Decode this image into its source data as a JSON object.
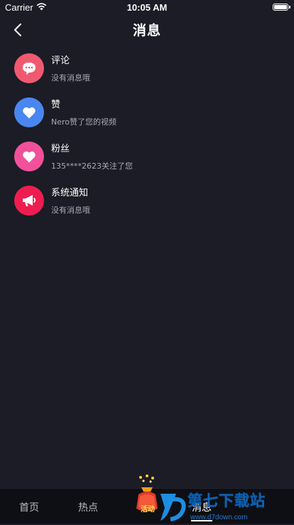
{
  "status": {
    "carrier": "Carrier",
    "time": "10:05 AM"
  },
  "nav": {
    "title": "消息"
  },
  "messages": [
    {
      "title": "评论",
      "subtitle": "没有消息哦",
      "icon": "comment-icon",
      "color": "#f05a70"
    },
    {
      "title": "赞",
      "subtitle": "Nero赞了您的视频",
      "icon": "heart-icon",
      "color": "#4a86f0"
    },
    {
      "title": "粉丝",
      "subtitle": "135****2623关注了您",
      "icon": "heart-icon",
      "color": "#f0519a"
    },
    {
      "title": "系统通知",
      "subtitle": "没有消息哦",
      "icon": "megaphone-icon",
      "color": "#ee1d50"
    }
  ],
  "tabs": [
    "首页",
    "热点",
    "消息"
  ],
  "promo": {
    "label": "活动"
  },
  "watermark": {
    "brand": "第七下载站",
    "url": "www.d7down.com"
  },
  "colors": {
    "background": "#1b1c25",
    "tabbar": "#0e0f14"
  }
}
